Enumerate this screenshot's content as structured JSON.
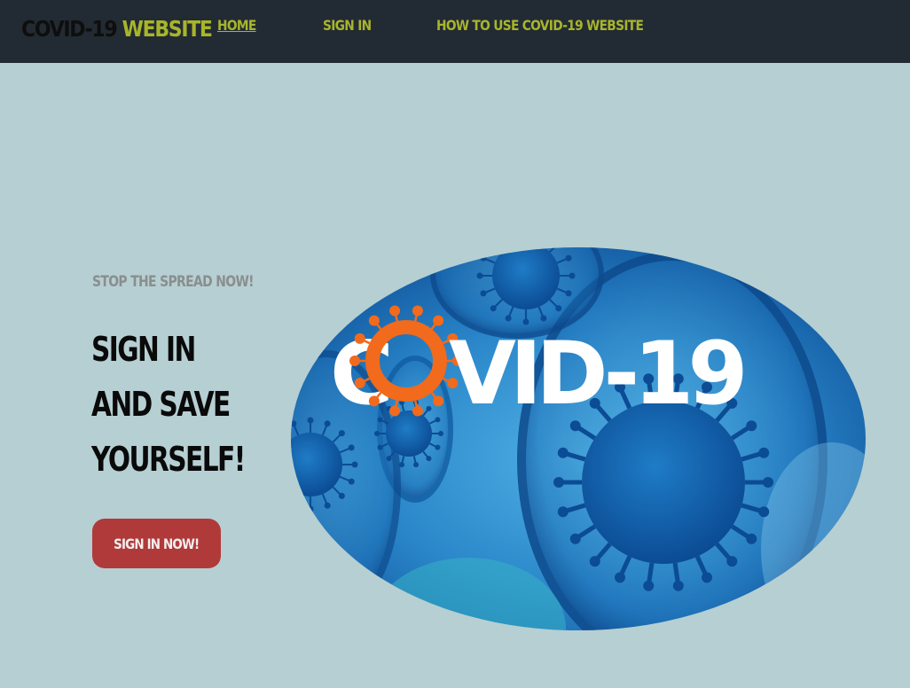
{
  "brand": {
    "part1": "COVID-19",
    "part2": "WEBSITE"
  },
  "nav": {
    "home": "HOME",
    "signin": "SIGN IN",
    "howto": "HOW TO USE COVID-19 WEBSITE"
  },
  "hero": {
    "kicker": "STOP THE SPREAD NOW!",
    "headline": [
      "SIGN IN",
      "AND SAVE",
      "YOURSELF!"
    ],
    "cta_label": "SIGN IN NOW!",
    "image": {
      "logo_text_left": "C",
      "logo_text_right": "VID-19"
    }
  },
  "colors": {
    "topbar": "#222b33",
    "accent": "#a8b52a",
    "background": "#b6cfd2",
    "cta": "#b03a3a",
    "virus_orange": "#f26a1b"
  }
}
